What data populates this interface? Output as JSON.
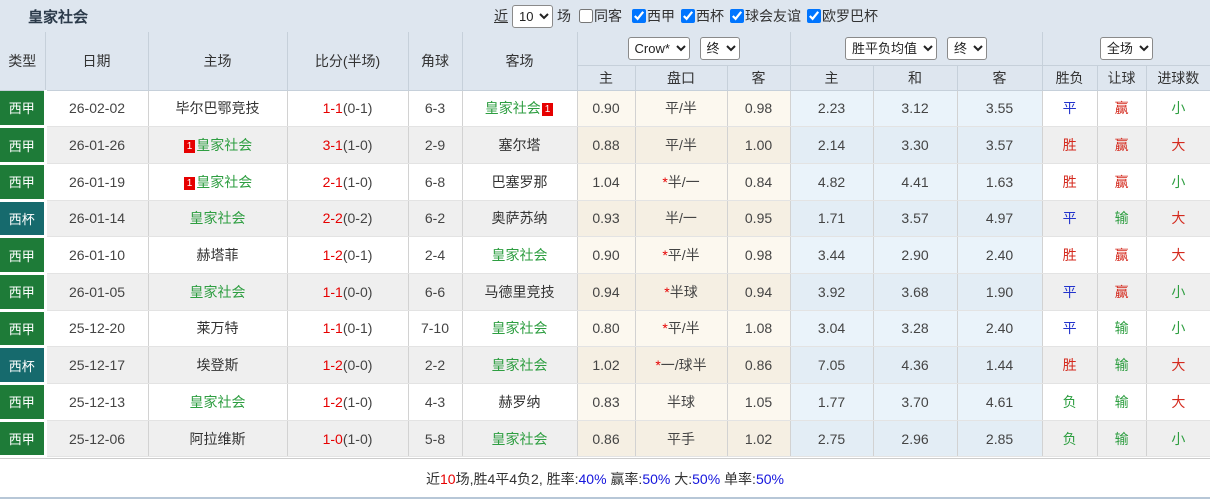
{
  "header": {
    "title": "皇家社会",
    "recent_label": "近",
    "recent_count": "10",
    "matches_label": "场",
    "same_venue_label": "同客",
    "same_venue_checked": false,
    "league_filters": [
      {
        "label": "西甲",
        "checked": true
      },
      {
        "label": "西杯",
        "checked": true
      },
      {
        "label": "球会友谊",
        "checked": true
      },
      {
        "label": "欧罗巴杯",
        "checked": true
      }
    ]
  },
  "controls": {
    "bookmaker": "Crow*",
    "ah_time": "终",
    "odds_type": "胜平负均值",
    "odds_time": "终",
    "scope": "全场"
  },
  "columns": {
    "type": "类型",
    "date": "日期",
    "home": "主场",
    "score": "比分(半场)",
    "corners": "角球",
    "away": "客场",
    "ah_home": "主",
    "ah_line": "盘口",
    "ah_away": "客",
    "odds_home": "主",
    "odds_draw": "和",
    "odds_away": "客",
    "result_wdl": "胜负",
    "result_handicap": "让球",
    "result_goals": "进球数"
  },
  "rows": [
    {
      "league": "西甲",
      "date": "26-02-02",
      "home": {
        "name": "毕尔巴鄂竞技",
        "focus": false,
        "badge_before": "",
        "badge_after": ""
      },
      "score": "1-1",
      "half": "(0-1)",
      "corners": "6-3",
      "away": {
        "name": "皇家社会",
        "focus": true,
        "badge_before": "",
        "badge_after": "1"
      },
      "ah": {
        "home": "0.90",
        "star": false,
        "line": "平/半",
        "away": "0.98"
      },
      "odds": {
        "home": "2.23",
        "draw": "3.12",
        "away": "3.55"
      },
      "results": {
        "wdl": "平",
        "handicap": "赢",
        "goals": "小"
      }
    },
    {
      "league": "西甲",
      "date": "26-01-26",
      "home": {
        "name": "皇家社会",
        "focus": true,
        "badge_before": "1",
        "badge_after": ""
      },
      "score": "3-1",
      "half": "(1-0)",
      "corners": "2-9",
      "away": {
        "name": "塞尔塔",
        "focus": false,
        "badge_before": "",
        "badge_after": ""
      },
      "ah": {
        "home": "0.88",
        "star": false,
        "line": "平/半",
        "away": "1.00"
      },
      "odds": {
        "home": "2.14",
        "draw": "3.30",
        "away": "3.57"
      },
      "results": {
        "wdl": "胜",
        "handicap": "赢",
        "goals": "大"
      }
    },
    {
      "league": "西甲",
      "date": "26-01-19",
      "home": {
        "name": "皇家社会",
        "focus": true,
        "badge_before": "1",
        "badge_after": ""
      },
      "score": "2-1",
      "half": "(1-0)",
      "corners": "6-8",
      "away": {
        "name": "巴塞罗那",
        "focus": false,
        "badge_before": "",
        "badge_after": ""
      },
      "ah": {
        "home": "1.04",
        "star": true,
        "line": "半/一",
        "away": "0.84"
      },
      "odds": {
        "home": "4.82",
        "draw": "4.41",
        "away": "1.63"
      },
      "results": {
        "wdl": "胜",
        "handicap": "赢",
        "goals": "小"
      }
    },
    {
      "league": "西杯",
      "date": "26-01-14",
      "home": {
        "name": "皇家社会",
        "focus": true,
        "badge_before": "",
        "badge_after": ""
      },
      "score": "2-2",
      "half": "(0-2)",
      "corners": "6-2",
      "away": {
        "name": "奥萨苏纳",
        "focus": false,
        "badge_before": "",
        "badge_after": ""
      },
      "ah": {
        "home": "0.93",
        "star": false,
        "line": "半/一",
        "away": "0.95"
      },
      "odds": {
        "home": "1.71",
        "draw": "3.57",
        "away": "4.97"
      },
      "results": {
        "wdl": "平",
        "handicap": "输",
        "goals": "大"
      }
    },
    {
      "league": "西甲",
      "date": "26-01-10",
      "home": {
        "name": "赫塔菲",
        "focus": false,
        "badge_before": "",
        "badge_after": ""
      },
      "score": "1-2",
      "half": "(0-1)",
      "corners": "2-4",
      "away": {
        "name": "皇家社会",
        "focus": true,
        "badge_before": "",
        "badge_after": ""
      },
      "ah": {
        "home": "0.90",
        "star": true,
        "line": "平/半",
        "away": "0.98"
      },
      "odds": {
        "home": "3.44",
        "draw": "2.90",
        "away": "2.40"
      },
      "results": {
        "wdl": "胜",
        "handicap": "赢",
        "goals": "大"
      }
    },
    {
      "league": "西甲",
      "date": "26-01-05",
      "home": {
        "name": "皇家社会",
        "focus": true,
        "badge_before": "",
        "badge_after": ""
      },
      "score": "1-1",
      "half": "(0-0)",
      "corners": "6-6",
      "away": {
        "name": "马德里竞技",
        "focus": false,
        "badge_before": "",
        "badge_after": ""
      },
      "ah": {
        "home": "0.94",
        "star": true,
        "line": "半球",
        "away": "0.94"
      },
      "odds": {
        "home": "3.92",
        "draw": "3.68",
        "away": "1.90"
      },
      "results": {
        "wdl": "平",
        "handicap": "赢",
        "goals": "小"
      }
    },
    {
      "league": "西甲",
      "date": "25-12-20",
      "home": {
        "name": "莱万特",
        "focus": false,
        "badge_before": "",
        "badge_after": ""
      },
      "score": "1-1",
      "half": "(0-1)",
      "corners": "7-10",
      "away": {
        "name": "皇家社会",
        "focus": true,
        "badge_before": "",
        "badge_after": ""
      },
      "ah": {
        "home": "0.80",
        "star": true,
        "line": "平/半",
        "away": "1.08"
      },
      "odds": {
        "home": "3.04",
        "draw": "3.28",
        "away": "2.40"
      },
      "results": {
        "wdl": "平",
        "handicap": "输",
        "goals": "小"
      }
    },
    {
      "league": "西杯",
      "date": "25-12-17",
      "home": {
        "name": "埃登斯",
        "focus": false,
        "badge_before": "",
        "badge_after": ""
      },
      "score": "1-2",
      "half": "(0-0)",
      "corners": "2-2",
      "away": {
        "name": "皇家社会",
        "focus": true,
        "badge_before": "",
        "badge_after": ""
      },
      "ah": {
        "home": "1.02",
        "star": true,
        "line": "一/球半",
        "away": "0.86"
      },
      "odds": {
        "home": "7.05",
        "draw": "4.36",
        "away": "1.44"
      },
      "results": {
        "wdl": "胜",
        "handicap": "输",
        "goals": "大"
      }
    },
    {
      "league": "西甲",
      "date": "25-12-13",
      "home": {
        "name": "皇家社会",
        "focus": true,
        "badge_before": "",
        "badge_after": ""
      },
      "score": "1-2",
      "half": "(1-0)",
      "corners": "4-3",
      "away": {
        "name": "赫罗纳",
        "focus": false,
        "badge_before": "",
        "badge_after": ""
      },
      "ah": {
        "home": "0.83",
        "star": false,
        "line": "半球",
        "away": "1.05"
      },
      "odds": {
        "home": "1.77",
        "draw": "3.70",
        "away": "4.61"
      },
      "results": {
        "wdl": "负",
        "handicap": "输",
        "goals": "大"
      }
    },
    {
      "league": "西甲",
      "date": "25-12-06",
      "home": {
        "name": "阿拉维斯",
        "focus": false,
        "badge_before": "",
        "badge_after": ""
      },
      "score": "1-0",
      "half": "(1-0)",
      "corners": "5-8",
      "away": {
        "name": "皇家社会",
        "focus": true,
        "badge_before": "",
        "badge_after": ""
      },
      "ah": {
        "home": "0.86",
        "star": false,
        "line": "平手",
        "away": "1.02"
      },
      "odds": {
        "home": "2.75",
        "draw": "2.96",
        "away": "2.85"
      },
      "results": {
        "wdl": "负",
        "handicap": "输",
        "goals": "小"
      }
    }
  ],
  "summary": {
    "segments": [
      {
        "text": "近",
        "color": "dark"
      },
      {
        "text": "10",
        "color": "red"
      },
      {
        "text": "场,胜4平4负2, 胜率:",
        "color": "dark"
      },
      {
        "text": "40%",
        "color": "blue"
      },
      {
        "text": " 赢率:",
        "color": "dark"
      },
      {
        "text": "50%",
        "color": "blue"
      },
      {
        "text": " 大:",
        "color": "dark"
      },
      {
        "text": "50%",
        "color": "blue"
      },
      {
        "text": " 单率:",
        "color": "dark"
      },
      {
        "text": "50%",
        "color": "blue"
      }
    ]
  },
  "colors": {
    "liga_badge": "#1e7b38",
    "cup_badge": "#166a6d",
    "focus_team_green": "#2e9e41",
    "score_red": "#e60000",
    "result_red": "#d42a1e",
    "result_blue": "#2233cc",
    "result_green": "#2e9e41",
    "header_bg": "#dee6ef"
  }
}
